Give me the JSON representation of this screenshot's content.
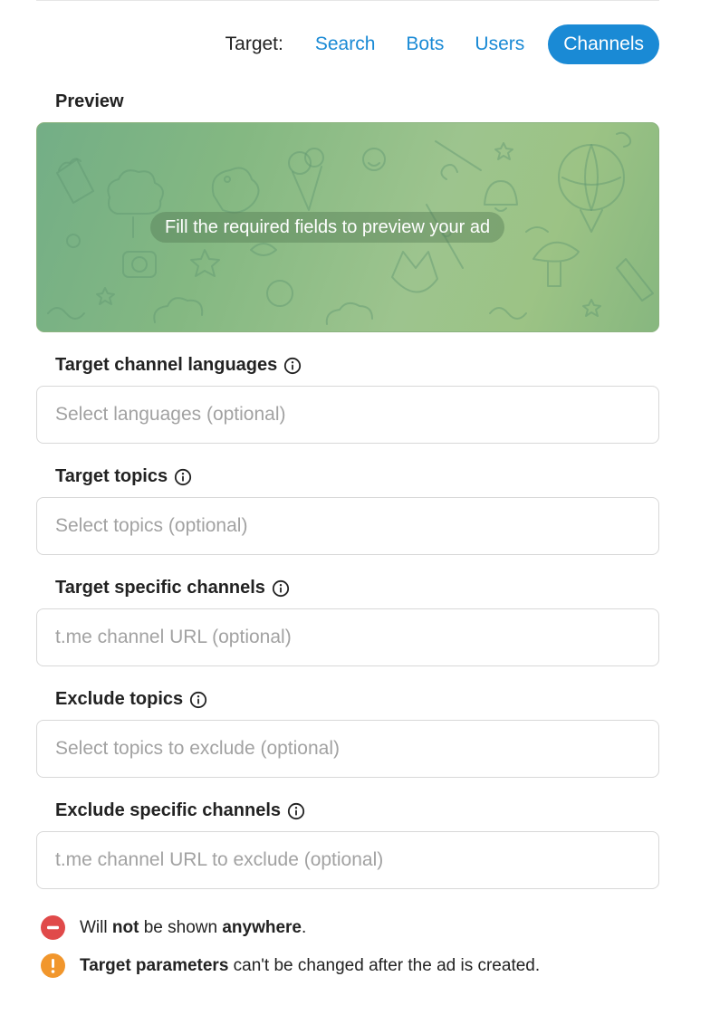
{
  "target": {
    "label": "Target:",
    "tabs": [
      {
        "label": "Search",
        "active": false
      },
      {
        "label": "Bots",
        "active": false
      },
      {
        "label": "Users",
        "active": false
      },
      {
        "label": "Channels",
        "active": true
      }
    ]
  },
  "preview": {
    "title": "Preview",
    "message": "Fill the required fields to preview your ad"
  },
  "fields": [
    {
      "label": "Target channel languages",
      "placeholder": "Select languages (optional)",
      "value": ""
    },
    {
      "label": "Target topics",
      "placeholder": "Select topics (optional)",
      "value": ""
    },
    {
      "label": "Target specific channels",
      "placeholder": "t.me channel URL (optional)",
      "value": ""
    },
    {
      "label": "Exclude topics",
      "placeholder": "Select topics to exclude (optional)",
      "value": ""
    },
    {
      "label": "Exclude specific channels",
      "placeholder": "t.me channel URL to exclude (optional)",
      "value": ""
    }
  ],
  "notes": {
    "not_shown": {
      "icon": "minus-circle-icon",
      "color": "#e04a4a",
      "part1": "Will ",
      "bold1": "not",
      "part2": " be shown ",
      "bold2": "anywhere",
      "part3": "."
    },
    "warning": {
      "icon": "exclamation-circle-icon",
      "color": "#f1962c",
      "bold": "Target parameters",
      "rest": " can't be changed after the ad is created."
    }
  },
  "colors": {
    "accent": "#1a8ad5",
    "preview_green": "#84b882"
  }
}
